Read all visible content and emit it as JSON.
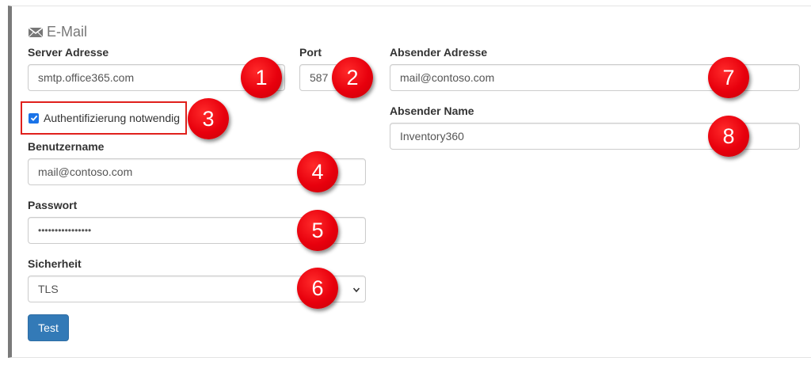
{
  "section": {
    "title": "E-Mail",
    "icon": "envelope-icon"
  },
  "server": {
    "label": "Server Adresse",
    "value": "smtp.office365.com"
  },
  "port": {
    "label": "Port",
    "value": "587"
  },
  "auth": {
    "label": "Authentifizierung notwendig",
    "checked": true
  },
  "username": {
    "label": "Benutzername",
    "value": "mail@contoso.com"
  },
  "password": {
    "label": "Passwort",
    "value": "••••••••••••••••"
  },
  "security": {
    "label": "Sicherheit",
    "value": "TLS"
  },
  "test_button": {
    "label": "Test"
  },
  "sender_address": {
    "label": "Absender Adresse",
    "value": "mail@contoso.com"
  },
  "sender_name": {
    "label": "Absender Name",
    "value": "Inventory360"
  },
  "callouts": [
    "1",
    "2",
    "3",
    "4",
    "5",
    "6",
    "7",
    "8"
  ],
  "colors": {
    "accent": "#337ab7",
    "callout": "#e8000d",
    "highlight_border": "#e0201c",
    "panel_border": "#7a7a7a"
  }
}
